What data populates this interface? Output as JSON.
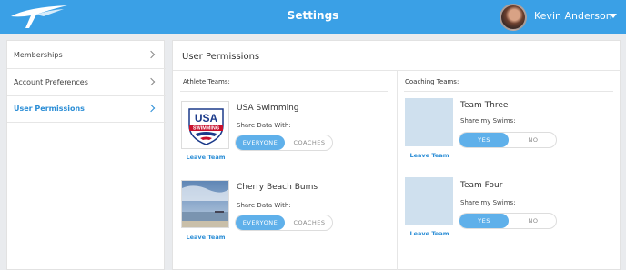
{
  "header": {
    "title": "Settings",
    "user_name": "Kevin Anderson"
  },
  "sidebar": {
    "items": [
      {
        "label": "Memberships"
      },
      {
        "label": "Account Preferences"
      },
      {
        "label": "User Permissions"
      }
    ]
  },
  "main": {
    "title": "User Permissions",
    "athlete": {
      "heading": "Athlete Teams:",
      "teams": [
        {
          "name": "USA Swimming",
          "share_label": "Share Data With:",
          "options": [
            "EVERYONE",
            "COACHES"
          ],
          "selected": "EVERYONE",
          "leave": "Leave Team",
          "logo_text": "USA",
          "logo_subtext": "SWIMMING"
        },
        {
          "name": "Cherry Beach Bums",
          "share_label": "Share Data With:",
          "options": [
            "EVERYONE",
            "COACHES"
          ],
          "selected": "EVERYONE",
          "leave": "Leave Team"
        }
      ]
    },
    "coaching": {
      "heading": "Coaching Teams:",
      "teams": [
        {
          "name": "Team Three",
          "share_label": "Share my Swims:",
          "options": [
            "YES",
            "NO"
          ],
          "selected": "YES",
          "leave": "Leave Team"
        },
        {
          "name": "Team Four",
          "share_label": "Share my Swims:",
          "options": [
            "YES",
            "NO"
          ],
          "selected": "YES",
          "leave": "Leave Team"
        }
      ]
    }
  },
  "colors": {
    "header_bg": "#3aa0e6",
    "accent": "#2c8ed6",
    "toggle_on": "#5fb0ea",
    "placeholder": "#cfe0ee"
  }
}
